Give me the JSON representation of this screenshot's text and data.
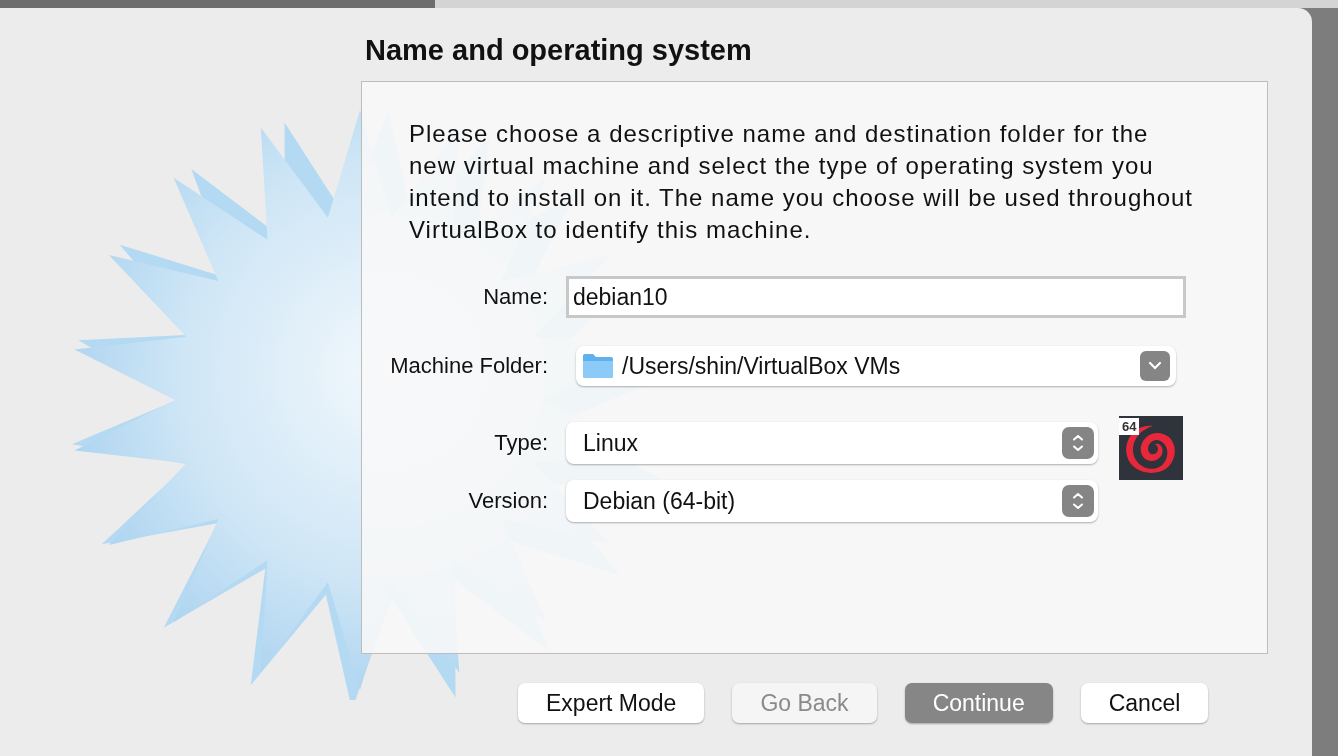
{
  "dialog": {
    "title": "Name and operating system",
    "description": "Please choose a descriptive name and destination folder for the new virtual machine and select the type of operating system you intend to install on it. The name you choose will be used throughout VirtualBox to identify this machine.",
    "name_field": {
      "label": "Name:",
      "value": "debian10"
    },
    "folder_field": {
      "label": "Machine Folder:",
      "value": "/Users/shin/VirtualBox VMs"
    },
    "selects": [
      {
        "label": "Type:",
        "value": "Linux"
      },
      {
        "label": "Version:",
        "value": "Debian (64-bit)"
      }
    ],
    "os_badge": "64",
    "buttons": [
      {
        "label": "Expert Mode",
        "kind": "normal",
        "disabled": false
      },
      {
        "label": "Go Back",
        "kind": "normal",
        "disabled": true
      },
      {
        "label": "Continue",
        "kind": "default",
        "disabled": false
      },
      {
        "label": "Cancel",
        "kind": "normal",
        "disabled": false
      }
    ]
  }
}
